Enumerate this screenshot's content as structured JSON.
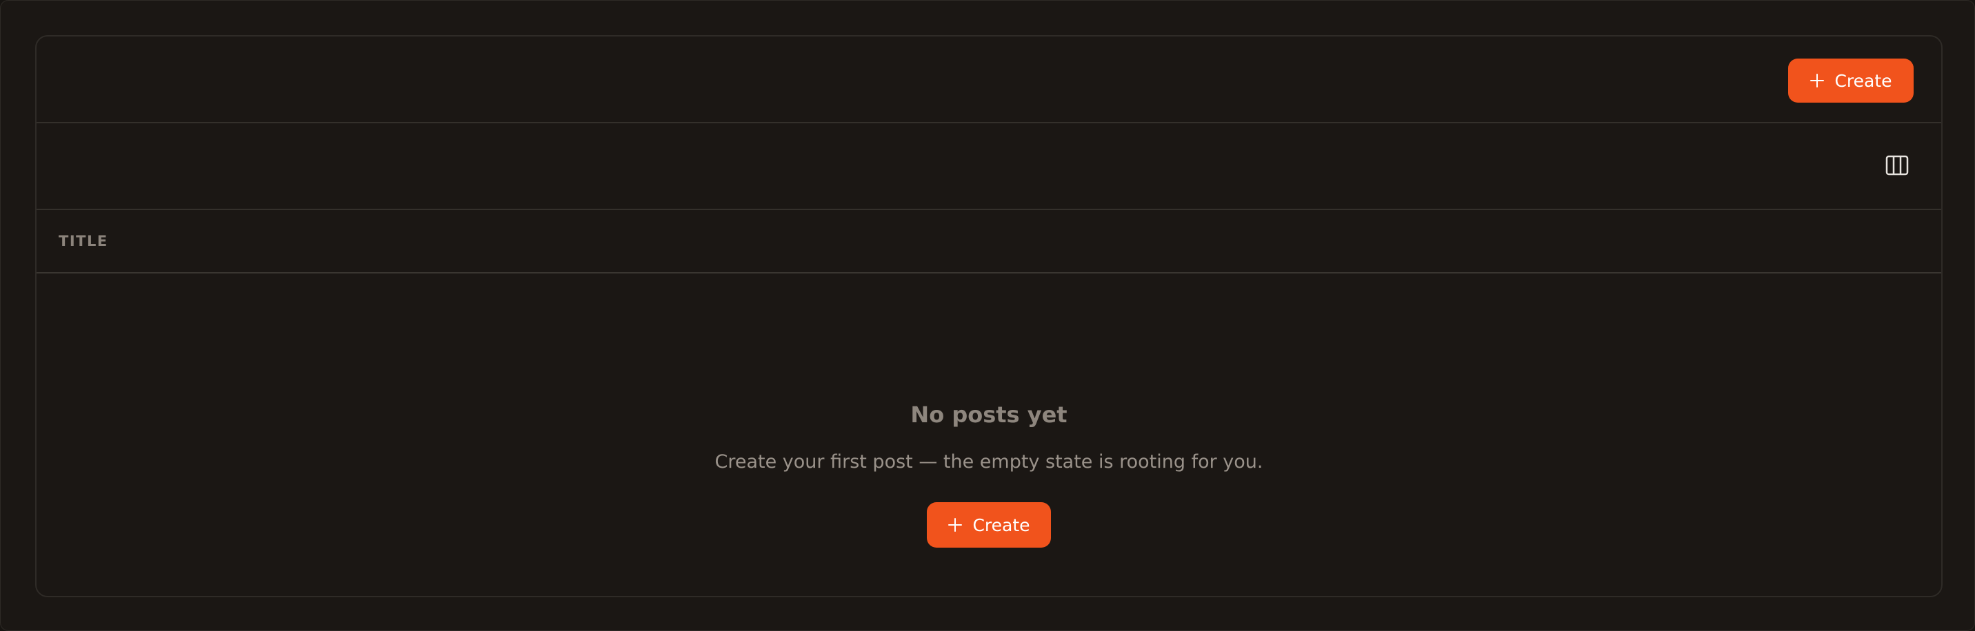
{
  "toolbar": {
    "create_label": "Create"
  },
  "table": {
    "columns": [
      "TITLE"
    ]
  },
  "empty_state": {
    "title": "No posts yet",
    "description": "Create your first post — the empty state is rooting for you.",
    "create_label": "Create"
  },
  "icons": {
    "create": "plus-icon",
    "columns": "columns-icon"
  },
  "colors": {
    "accent": "#f1531c",
    "background": "#1b1714",
    "border": "#34302b",
    "muted_text": "#8e867e"
  }
}
